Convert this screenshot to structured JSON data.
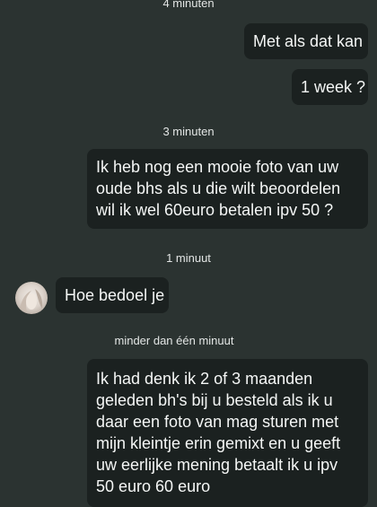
{
  "timestamps": {
    "t1": "4 minuten",
    "t2": "3 minuten",
    "t3": "1 minuut",
    "t4": "minder dan één minuut"
  },
  "messages": {
    "m1": "Met als dat kan",
    "m2": "1 week ?",
    "m3": [
      "Ik heb nog een mooie foto van uw",
      "oude bhs als u die wilt beoordelen",
      "wil ik wel 60euro betalen ipv 50 ?"
    ],
    "m4": "Hoe bedoel je",
    "m5": [
      "Ik had denk ik 2 of 3 maanden",
      "geleden bh's bij u besteld als ik u",
      "daar een foto van mag sturen met",
      "mijn kleintje erin gemixt en u geeft",
      "uw eerlijke mening betaalt ik u ipv",
      "50 euro 60 euro"
    ]
  },
  "colors": {
    "background": "#2b3331",
    "bubble": "#1b2120",
    "text": "#f4f6f5"
  },
  "icons": {
    "contact_avatar": "avatar-photo"
  }
}
